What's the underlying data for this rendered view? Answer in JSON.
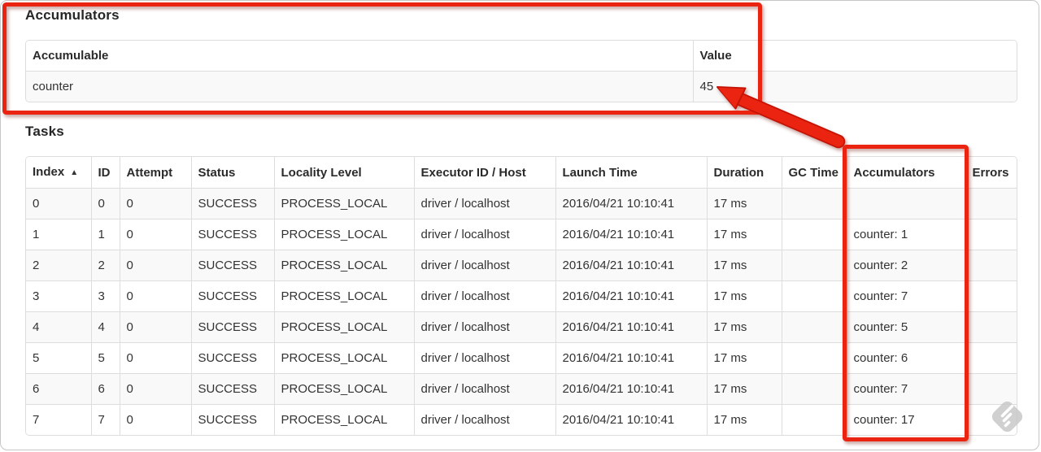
{
  "accumulators_section": {
    "title": "Accumulators",
    "table": {
      "headers": [
        "Accumulable",
        "Value"
      ],
      "rows": [
        [
          "counter",
          "45"
        ]
      ]
    }
  },
  "tasks_section": {
    "title": "Tasks",
    "table": {
      "headers": [
        "Index",
        "ID",
        "Attempt",
        "Status",
        "Locality Level",
        "Executor ID / Host",
        "Launch Time",
        "Duration",
        "GC Time",
        "Accumulators",
        "Errors"
      ],
      "sort_column": "Index",
      "sort_icon": "▲",
      "rows": [
        [
          "0",
          "0",
          "0",
          "SUCCESS",
          "PROCESS_LOCAL",
          "driver / localhost",
          "2016/04/21 10:10:41",
          "17 ms",
          "",
          "",
          ""
        ],
        [
          "1",
          "1",
          "0",
          "SUCCESS",
          "PROCESS_LOCAL",
          "driver / localhost",
          "2016/04/21 10:10:41",
          "17 ms",
          "",
          "counter: 1",
          ""
        ],
        [
          "2",
          "2",
          "0",
          "SUCCESS",
          "PROCESS_LOCAL",
          "driver / localhost",
          "2016/04/21 10:10:41",
          "17 ms",
          "",
          "counter: 2",
          ""
        ],
        [
          "3",
          "3",
          "0",
          "SUCCESS",
          "PROCESS_LOCAL",
          "driver / localhost",
          "2016/04/21 10:10:41",
          "17 ms",
          "",
          "counter: 7",
          ""
        ],
        [
          "4",
          "4",
          "0",
          "SUCCESS",
          "PROCESS_LOCAL",
          "driver / localhost",
          "2016/04/21 10:10:41",
          "17 ms",
          "",
          "counter: 5",
          ""
        ],
        [
          "5",
          "5",
          "0",
          "SUCCESS",
          "PROCESS_LOCAL",
          "driver / localhost",
          "2016/04/21 10:10:41",
          "17 ms",
          "",
          "counter: 6",
          ""
        ],
        [
          "6",
          "6",
          "0",
          "SUCCESS",
          "PROCESS_LOCAL",
          "driver / localhost",
          "2016/04/21 10:10:41",
          "17 ms",
          "",
          "counter: 7",
          ""
        ],
        [
          "7",
          "7",
          "0",
          "SUCCESS",
          "PROCESS_LOCAL",
          "driver / localhost",
          "2016/04/21 10:10:41",
          "17 ms",
          "",
          "counter: 17",
          ""
        ]
      ]
    }
  },
  "colors": {
    "annotation_red": "#ea2410",
    "annotation_red_dark": "#c41305",
    "table_border": "#dddddd",
    "row_stripe": "#f9f9f9",
    "text": "#333333",
    "watermark_gray": "#c8c8c8"
  },
  "icons": {
    "sort_ascending": "▲",
    "watermark": "diamond-stripes-watermark"
  }
}
